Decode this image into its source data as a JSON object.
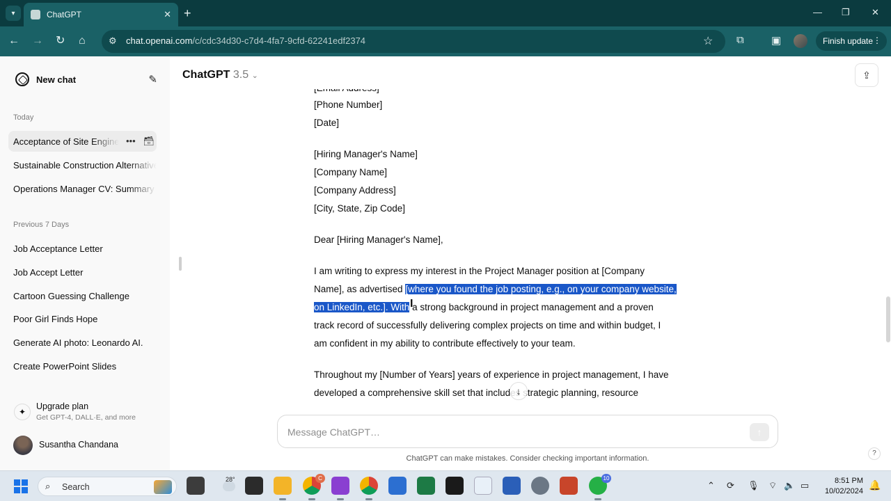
{
  "browser": {
    "tab_title": "ChatGPT",
    "url_host": "chat.openai.com",
    "url_path": "/c/cdc34d30-c7d4-4fa7-9cfd-62241edf2374",
    "finish_update_label": "Finish update",
    "icons": [
      "tab-list-icon",
      "close-icon",
      "plus-icon",
      "back-icon",
      "forward-icon",
      "reload-icon",
      "home-icon",
      "site-settings-icon",
      "star-icon",
      "extensions-icon",
      "sidepanel-icon",
      "kebab-icon"
    ]
  },
  "sidebar": {
    "new_chat_label": "New chat",
    "today_label": "Today",
    "today_items": [
      {
        "label": "Acceptance of Site Engineer"
      },
      {
        "label": "Sustainable Construction Alternatives"
      },
      {
        "label": "Operations Manager CV: Summary"
      }
    ],
    "previous_label": "Previous 7 Days",
    "previous_items": [
      {
        "label": "Job Acceptance Letter"
      },
      {
        "label": "Job Accept Letter"
      },
      {
        "label": "Cartoon Guessing Challenge"
      },
      {
        "label": "Poor Girl Finds Hope"
      },
      {
        "label": "Generate AI photo: Leonardo AI."
      },
      {
        "label": "Create PowerPoint Slides"
      }
    ],
    "upgrade_title": "Upgrade plan",
    "upgrade_subtitle": "Get GPT-4, DALL·E, and more",
    "user_name": "Susantha Chandana"
  },
  "header": {
    "model_name": "ChatGPT",
    "model_version": "3.5"
  },
  "message": {
    "phone": "[Phone Number]",
    "date": "[Date]",
    "addressee": [
      "[Hiring Manager's Name]",
      "[Company Name]",
      "[Company Address]",
      "[City, State, Zip Code]"
    ],
    "salutation": "Dear [Hiring Manager's Name],",
    "para1_line1": "I am writing to express my interest in the Project Manager position at [Company",
    "para1_line2_pre": "Name], as advertised ",
    "para1_line2_hl": "[where you found the job posting, e.g., on your company website,",
    "para1_line3_hl": "on LinkedIn, etc.]. With",
    "para1_line3_post": " a strong background in project management and a proven",
    "para1_line4": "track record of successfully delivering complex projects on time and within budget, I",
    "para1_line5": "am confident in my ability to contribute effectively to your team.",
    "para2_line1": "Throughout my [Number of Years] years of experience in project management, I have",
    "para2_line2": "developed a comprehensive skill set that includes strategic planning, resource"
  },
  "composer": {
    "placeholder": "Message ChatGPT…",
    "disclaimer": "ChatGPT can make mistakes. Consider checking important information."
  },
  "taskbar": {
    "search_label": "Search",
    "weather_temp": "28°",
    "chrome_badge": "C",
    "whatsapp_badge": "10",
    "time": "8:51 PM",
    "date": "10/02/2024"
  }
}
